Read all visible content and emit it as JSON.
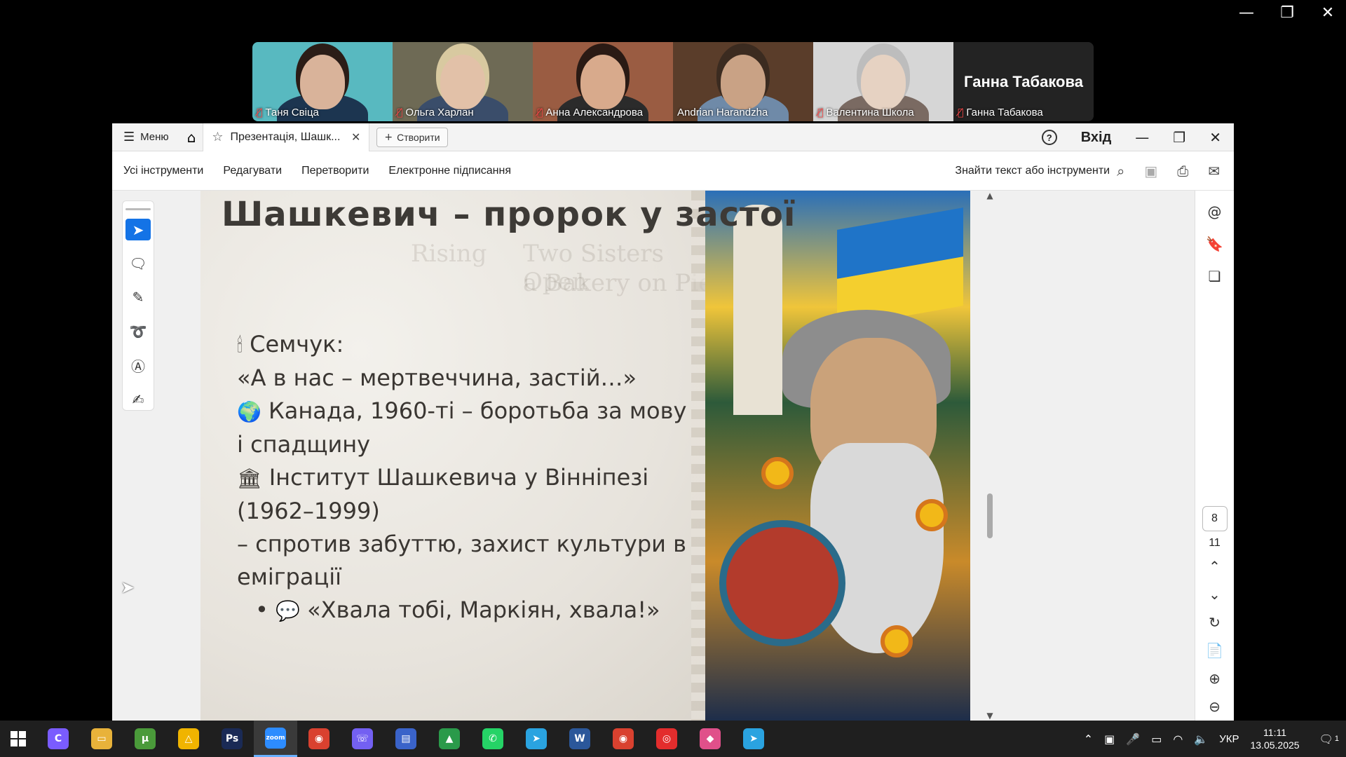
{
  "participants": [
    {
      "name": "Таня Свіца",
      "muted": true,
      "bg": "#58b9c0",
      "skin": "#d9b39a",
      "hair": "#2b1d17",
      "shirt": "#1c3550"
    },
    {
      "name": "Ольга Харлан",
      "muted": true,
      "bg": "#6e6a55",
      "skin": "#e2c1a8",
      "hair": "#d8c9a0",
      "shirt": "#3a4d6a"
    },
    {
      "name": "Анна Александрова",
      "muted": true,
      "bg": "#9a5c42",
      "skin": "#d8aa8c",
      "hair": "#2a1a14",
      "shirt": "#2b2b2b"
    },
    {
      "name": "Andrian Harandzha",
      "muted": false,
      "active": true,
      "bg": "#5a3d2a",
      "skin": "#c9a285",
      "hair": "#3b2b20",
      "shirt": "#6f8aa8"
    },
    {
      "name": "Валентина Школа",
      "muted": true,
      "bg": "#d6d6d6",
      "skin": "#e6d2c2",
      "hair": "#bdbdbd",
      "shirt": "#7a6a62"
    },
    {
      "name": "Ганна Табакова",
      "muted": true,
      "bg": "#232323",
      "video_off": true
    }
  ],
  "acrobat": {
    "menu_label": "Меню",
    "tab_title": "Презентація, Шашк...",
    "create_label": "Створити",
    "signin_label": "Вхід",
    "toolbar": [
      "Усі інструменти",
      "Редагувати",
      "Перетворити",
      "Електронне підписання"
    ],
    "search_label": "Знайти текст або інструменти",
    "current_page": "8",
    "total_pages": "11"
  },
  "slide": {
    "title": "Шашкевич – пророк у застої",
    "ghost_text": [
      "Rising",
      "Two Sisters Open",
      "a Bakery on Pie"
    ],
    "lines": [
      {
        "emoji": "🕯",
        "text": "Семчук:"
      },
      {
        "emoji": "",
        "text": "«А в нас – мертвеччина, застій…»"
      },
      {
        "emoji": "🌍",
        "text": "Канада, 1960-ті – боротьба за мову"
      },
      {
        "emoji": "",
        "text": "і спадщину"
      },
      {
        "emoji": "🏛",
        "text": "Інститут Шашкевича у Вінніпезі"
      },
      {
        "emoji": "",
        "text": "(1962–1999)"
      },
      {
        "emoji": "",
        "text": "– спротив забуттю, захист культури в"
      },
      {
        "emoji": "",
        "text": "еміграції"
      }
    ],
    "bullet": {
      "emoji": "💬",
      "text": "«Хвала тобі, Маркіян, хвала!»"
    }
  },
  "taskbar": {
    "apps": [
      {
        "label": "C",
        "color": "#7a5cff"
      },
      {
        "label": "▭",
        "color": "#e8b23a"
      },
      {
        "label": "µ",
        "color": "#4a9a3a"
      },
      {
        "label": "△",
        "color": "#f0b400"
      },
      {
        "label": "Ps",
        "color": "#1a2a55"
      },
      {
        "label": "zoom",
        "color": "#2d8cff",
        "active": true
      },
      {
        "label": "◉",
        "color": "#d9412f"
      },
      {
        "label": "☏",
        "color": "#7360f2"
      },
      {
        "label": "▤",
        "color": "#3a63c9"
      },
      {
        "label": "▲",
        "color": "#2a9a4a"
      },
      {
        "label": "✆",
        "color": "#25d366"
      },
      {
        "label": "➤",
        "color": "#2aa3e0"
      },
      {
        "label": "W",
        "color": "#2b579a"
      },
      {
        "label": "◉",
        "color": "#d9412f"
      },
      {
        "label": "◎",
        "color": "#e32d2d"
      },
      {
        "label": "◆",
        "color": "#e0508a"
      },
      {
        "label": "➤",
        "color": "#2aa3e0"
      }
    ],
    "language": "УКР",
    "time": "11:11",
    "date": "13.05.2025",
    "notifications": "1"
  }
}
